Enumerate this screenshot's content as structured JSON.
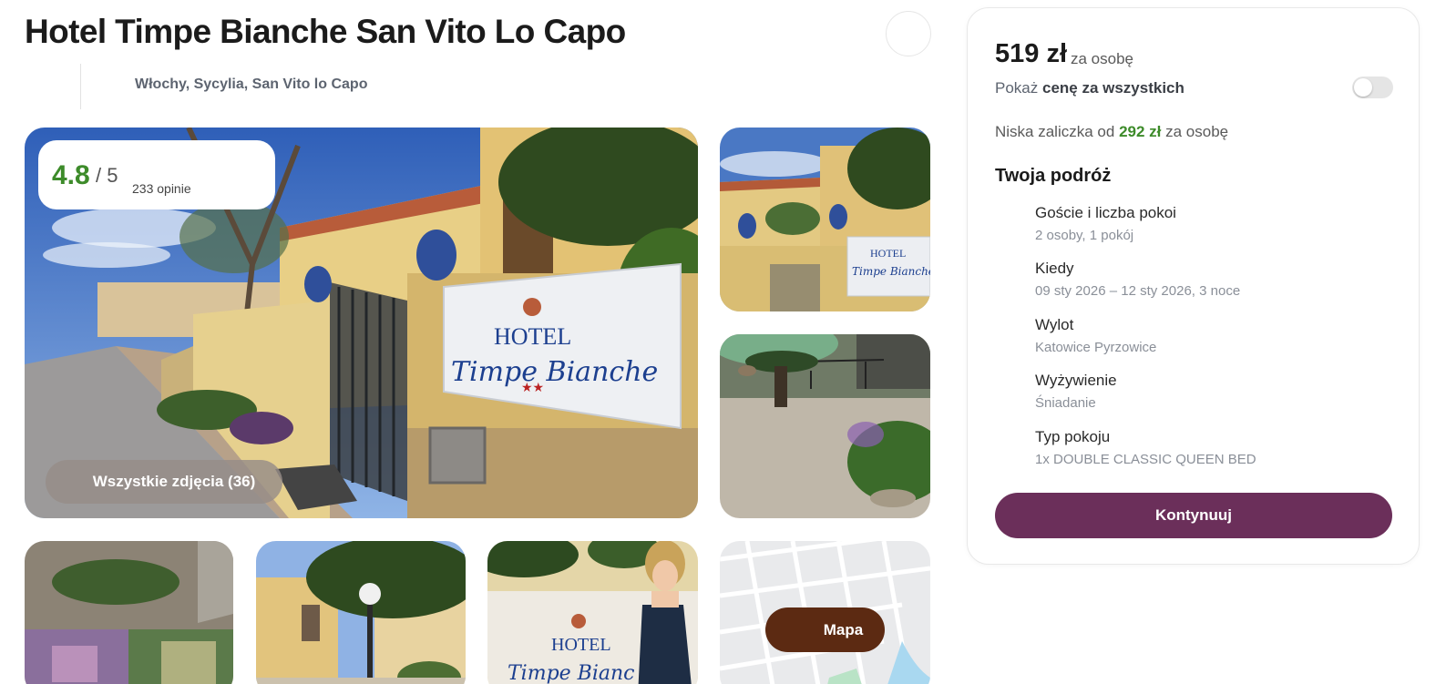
{
  "hotel": {
    "title": "Hotel Timpe Bianche San Vito Lo Capo",
    "location": "Włochy, Sycylia, San Vito lo Capo"
  },
  "gallery": {
    "rating_score": "4.8",
    "rating_max": "/ 5",
    "rating_count": "233 opinie",
    "all_photos_label": "Wszystkie zdjęcia (36)",
    "map_label": "Mapa",
    "sign_line1": "HOTEL",
    "sign_line2": "Timpe Bianche",
    "sign_small_line1": "HOTEL",
    "sign_small_line2": "Timpe Bianche"
  },
  "booking": {
    "price": "519 zł",
    "price_unit": "za osobę",
    "show_total_prefix": "Pokaż ",
    "show_total_bold": "cenę za wszystkich",
    "show_total_enabled": false,
    "deposit_prefix": "Niska zaliczka od",
    "deposit_amount": "292 zł",
    "deposit_suffix": "za osobę",
    "trip_heading": "Twoja podróż",
    "trip_items": [
      {
        "label": "Goście i liczba pokoi",
        "value": "2 osoby, 1 pokój"
      },
      {
        "label": "Kiedy",
        "value": "09 sty 2026 – 12 sty 2026, 3 noce"
      },
      {
        "label": "Wylot",
        "value": "Katowice Pyrzowice"
      },
      {
        "label": "Wyżywienie",
        "value": "Śniadanie"
      },
      {
        "label": "Typ pokoju",
        "value": "1x DOUBLE CLASSIC QUEEN BED"
      }
    ],
    "continue_label": "Kontynuuj"
  },
  "colors": {
    "rating_green": "#3d8b2a",
    "continue_purple": "#6b2f5a",
    "map_brown": "#5c2a12"
  }
}
